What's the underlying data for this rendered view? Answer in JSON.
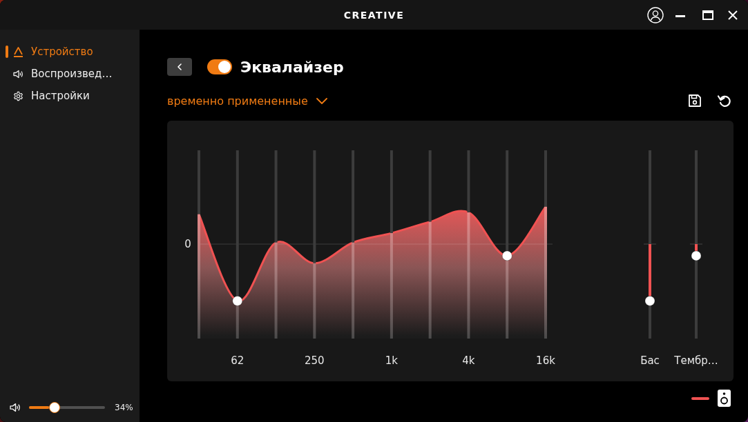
{
  "window": {
    "logo": "CREATIVE"
  },
  "sidebar": {
    "items": [
      {
        "kind": "device",
        "label": "Устройство",
        "selected": true
      },
      {
        "kind": "playback",
        "label": "Воспроизвед…",
        "selected": false
      },
      {
        "kind": "settings",
        "label": "Настройки",
        "selected": false
      }
    ],
    "volume": {
      "level": 0.34,
      "reading": "34%"
    }
  },
  "equalizer": {
    "title": "Эквалайзер",
    "on": true,
    "preset": {
      "value": "временно примененные"
    },
    "zero_label": "0",
    "bands": [
      {
        "level": 0.66,
        "handle": false
      },
      {
        "label": "62",
        "level": 0.2,
        "handle": true
      },
      {
        "level": 0.51,
        "handle": false
      },
      {
        "label": "250",
        "level": 0.4,
        "handle": false
      },
      {
        "level": 0.51,
        "handle": false
      },
      {
        "label": "1k",
        "level": 0.56,
        "handle": false
      },
      {
        "level": 0.62,
        "handle": false
      },
      {
        "label": "4k",
        "level": 0.67,
        "handle": false
      },
      {
        "level": 0.44,
        "handle": true
      },
      {
        "label": "16k",
        "level": 0.7,
        "handle": false
      }
    ],
    "tone_controls": [
      {
        "label": "Бас",
        "level": 0.2
      },
      {
        "label": "Тембр…",
        "level": 0.44
      }
    ]
  }
}
